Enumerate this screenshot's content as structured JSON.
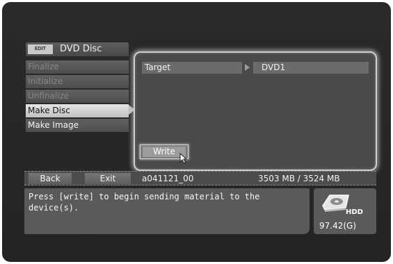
{
  "screen": {
    "edit_badge": "EDIT",
    "title": "DVD Disc"
  },
  "menu": {
    "items": [
      {
        "label": "Finalize",
        "state": "disabled"
      },
      {
        "label": "Initialize",
        "state": "disabled"
      },
      {
        "label": "Unfinalize",
        "state": "disabled"
      },
      {
        "label": "Make Disc",
        "state": "selected"
      },
      {
        "label": "Make Image",
        "state": "normal"
      }
    ]
  },
  "panel": {
    "target_label": "Target",
    "target_value": "DVD1",
    "write_label": "Write"
  },
  "status_bar": {
    "back_label": "Back",
    "exit_label": "Exit",
    "item_name": "a041121_00",
    "capacity": "3503 MB / 3524 MB"
  },
  "message": "Press [write] to begin sending material to the device(s).",
  "hdd": {
    "icon": "hdd-icon",
    "label": "HDD",
    "free": "97.42(G)"
  }
}
